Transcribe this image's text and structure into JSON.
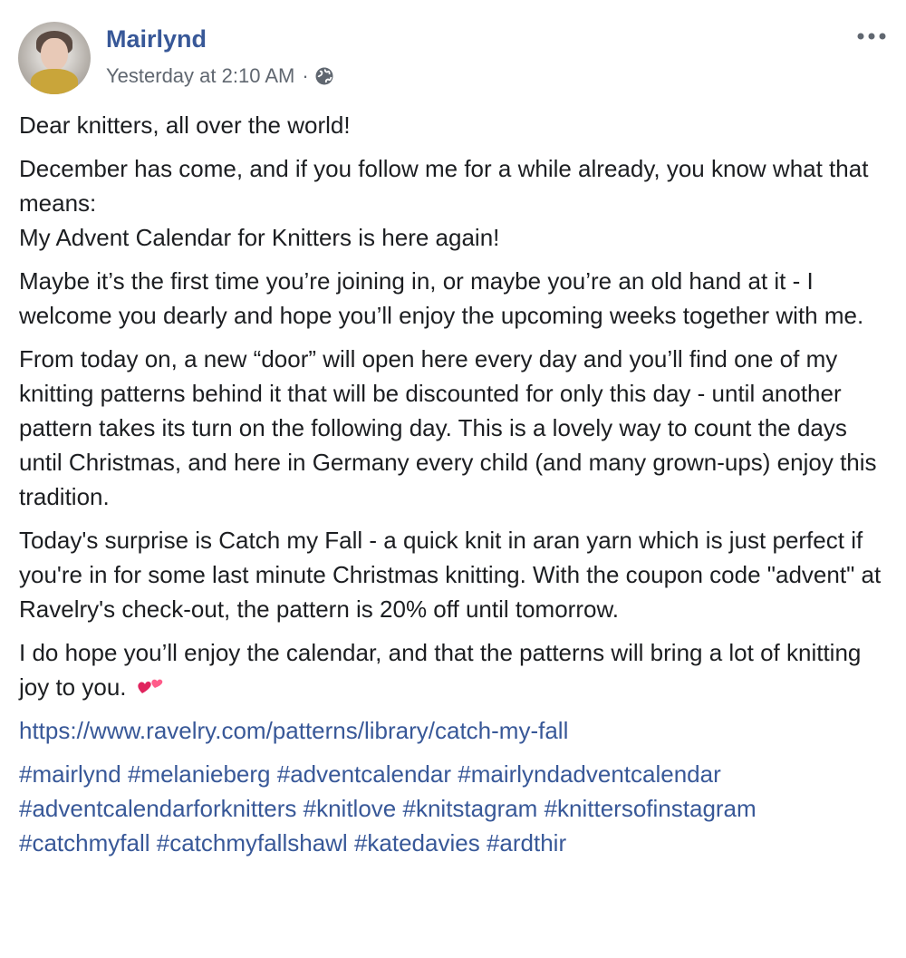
{
  "post": {
    "author": "Mairlynd",
    "timestamp": "Yesterday at 2:10 AM",
    "separator": "·",
    "privacy_icon": "globe-icon",
    "menu_icon": "more-icon"
  },
  "content": {
    "p1": "Dear knitters, all over the world!",
    "p2_line1": "December has come, and if you follow me for a while already, you know what that means:",
    "p2_line2": "My Advent Calendar for Knitters is here again!",
    "p3": "Maybe it’s the first time you’re joining in, or maybe you’re an old hand at it - I welcome you dearly and hope you’ll enjoy the upcoming weeks together with me.",
    "p4": "From today on, a new “door” will open here every day and you’ll find one of my knitting patterns behind it that will be discounted for only this day - until another pattern takes its turn on the following day. This is a lovely way to count the days until Christmas, and here in Germany every child (and many grown-ups) enjoy this tradition.",
    "p5": "Today's surprise is Catch my Fall - a quick knit in aran yarn which is just perfect if you're in for some last minute Christmas knitting. With the coupon code \"advent\" at Ravelry's check-out, the pattern is 20% off until tomorrow.",
    "p6": "I do hope you’ll enjoy the calendar, and that the patterns will bring a lot of knitting joy to you.",
    "p6_icon": "two-hearts-icon",
    "link": "https://www.ravelry.com/patterns/library/catch-my-fall",
    "hashtags": [
      "#mairlynd",
      "#melanieberg",
      "#adventcalendar",
      "#mairlyndadventcalendar",
      "#adventcalendarforknitters",
      "#knitlove",
      "#knitstagram",
      "#knittersofinstagram",
      "#catchmyfall",
      "#catchmyfallshawl",
      "#katedavies",
      "#ardthir"
    ]
  },
  "colors": {
    "link": "#385898",
    "meta": "#606770",
    "text": "#1c1e21"
  }
}
